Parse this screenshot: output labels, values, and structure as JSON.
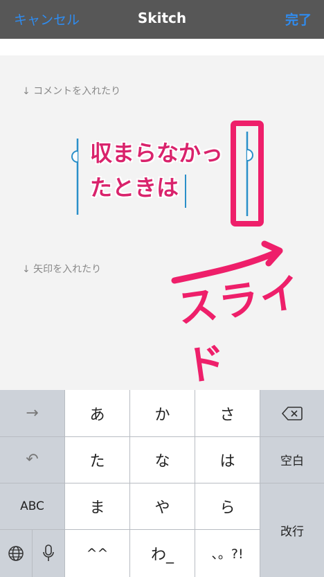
{
  "nav": {
    "cancel_label": "キャンセル",
    "title": "Skitch",
    "done_label": "完了"
  },
  "canvas": {
    "hint_comment": "↓ コメントを入れたり",
    "hint_arrow": "↓ 矢印を入れたり",
    "edit_text_line1": "収まらなかっ",
    "edit_text_line2": "たときは",
    "annotation_text": "スライド"
  },
  "keyboard": {
    "row1": [
      "あ",
      "か",
      "さ"
    ],
    "row2": [
      "た",
      "な",
      "は"
    ],
    "row3": [
      "ま",
      "や",
      "ら"
    ],
    "row4": [
      "^^",
      "わ_",
      "、。?!"
    ],
    "abc_label": "ABC",
    "space_label": "空白",
    "return_label": "改行"
  },
  "colors": {
    "accent": "#2f8cf0",
    "annotation": "#ee1f6a",
    "nav_bg": "#575757"
  }
}
